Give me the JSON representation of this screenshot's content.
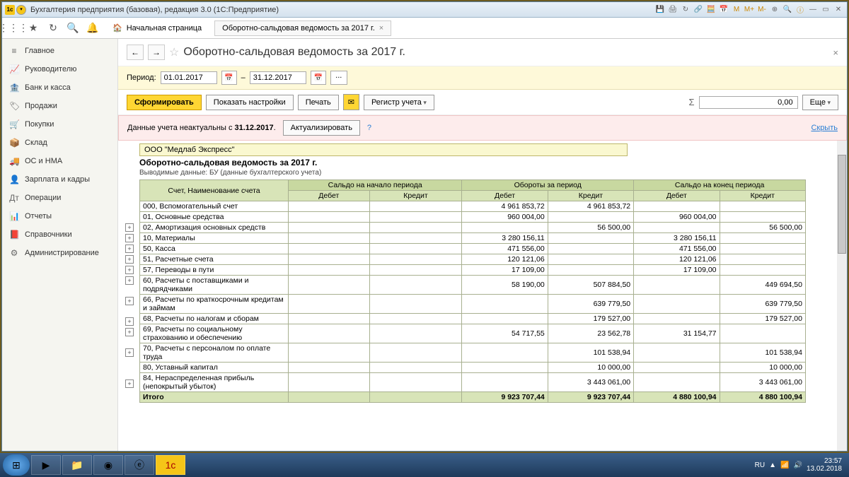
{
  "titlebar": {
    "title": "Бухгалтерия предприятия (базовая), редакция 3.0  (1С:Предприятие)"
  },
  "toolbar2": {
    "home_label": "Начальная страница",
    "tab_label": "Оборотно-сальдовая ведомость за 2017 г."
  },
  "sidebar": {
    "items": [
      {
        "icon": "≡",
        "label": "Главное"
      },
      {
        "icon": "📈",
        "label": "Руководителю"
      },
      {
        "icon": "🏦",
        "label": "Банк и касса"
      },
      {
        "icon": "🏷",
        "label": "Продажи"
      },
      {
        "icon": "🛒",
        "label": "Покупки"
      },
      {
        "icon": "📦",
        "label": "Склад"
      },
      {
        "icon": "🚚",
        "label": "ОС и НМА"
      },
      {
        "icon": "👤",
        "label": "Зарплата и кадры"
      },
      {
        "icon": "Дт",
        "label": "Операции"
      },
      {
        "icon": "📊",
        "label": "Отчеты"
      },
      {
        "icon": "📕",
        "label": "Справочники"
      },
      {
        "icon": "⚙",
        "label": "Администрирование"
      }
    ]
  },
  "page": {
    "title": "Оборотно-сальдовая ведомость за 2017 г.",
    "period_label": "Период:",
    "date_from": "01.01.2017",
    "date_to": "31.12.2017",
    "dash": "–",
    "form_btn": "Сформировать",
    "settings_btn": "Показать настройки",
    "print_btn": "Печать",
    "register_btn": "Регистр учета",
    "sum_value": "0,00",
    "more_btn": "Еще",
    "warn_text": "Данные учета неактуальны с ",
    "warn_date": "31.12.2017",
    "warn_update": "Актуализировать",
    "warn_hide": "Скрыть"
  },
  "report": {
    "org": "ООО \"Медлаб Экспресс\"",
    "title": "Оборотно-сальдовая ведомость за 2017 г.",
    "sub": "Выводимые данные:  БУ (данные бухгалтерского учета)",
    "col_account": "Счет, Наименование счета",
    "grp_start": "Сальдо на начало периода",
    "grp_turn": "Обороты за период",
    "grp_end": "Сальдо на конец периода",
    "col_debit": "Дебет",
    "col_credit": "Кредит",
    "rows": [
      {
        "acc": "000, Вспомогательный счет",
        "sd": "",
        "sc": "",
        "td": "4 961 853,72",
        "tc": "4 961 853,72",
        "ed": "",
        "ec": ""
      },
      {
        "acc": "01, Основные средства",
        "sd": "",
        "sc": "",
        "td": "960 004,00",
        "tc": "",
        "ed": "960 004,00",
        "ec": ""
      },
      {
        "acc": "02, Амортизация основных средств",
        "sd": "",
        "sc": "",
        "td": "",
        "tc": "56 500,00",
        "ed": "",
        "ec": "56 500,00"
      },
      {
        "acc": "10, Материалы",
        "sd": "",
        "sc": "",
        "td": "3 280 156,11",
        "tc": "",
        "ed": "3 280 156,11",
        "ec": ""
      },
      {
        "acc": "50, Касса",
        "sd": "",
        "sc": "",
        "td": "471 556,00",
        "tc": "",
        "ed": "471 556,00",
        "ec": ""
      },
      {
        "acc": "51, Расчетные счета",
        "sd": "",
        "sc": "",
        "td": "120 121,06",
        "tc": "",
        "ed": "120 121,06",
        "ec": ""
      },
      {
        "acc": "57, Переводы в пути",
        "sd": "",
        "sc": "",
        "td": "17 109,00",
        "tc": "",
        "ed": "17 109,00",
        "ec": ""
      },
      {
        "acc": "60, Расчеты с поставщиками и подрядчиками",
        "sd": "",
        "sc": "",
        "td": "58 190,00",
        "tc": "507 884,50",
        "ed": "",
        "ec": "449 694,50"
      },
      {
        "acc": "66, Расчеты по краткосрочным кредитам и займам",
        "sd": "",
        "sc": "",
        "td": "",
        "tc": "639 779,50",
        "ed": "",
        "ec": "639 779,50"
      },
      {
        "acc": "68, Расчеты по налогам и сборам",
        "sd": "",
        "sc": "",
        "td": "",
        "tc": "179 527,00",
        "ed": "",
        "ec": "179 527,00"
      },
      {
        "acc": "69, Расчеты по социальному страхованию и обеспечению",
        "sd": "",
        "sc": "",
        "td": "54 717,55",
        "tc": "23 562,78",
        "ed": "31 154,77",
        "ec": ""
      },
      {
        "acc": "70, Расчеты с персоналом по оплате труда",
        "sd": "",
        "sc": "",
        "td": "",
        "tc": "101 538,94",
        "ed": "",
        "ec": "101 538,94"
      },
      {
        "acc": "80, Уставный капитал",
        "sd": "",
        "sc": "",
        "td": "",
        "tc": "10 000,00",
        "ed": "",
        "ec": "10 000,00"
      },
      {
        "acc": "84, Нераспределенная прибыль (непокрытый убыток)",
        "sd": "",
        "sc": "",
        "td": "",
        "tc": "3 443 061,00",
        "ed": "",
        "ec": "3 443 061,00"
      }
    ],
    "total_label": "Итого",
    "total": {
      "sd": "",
      "sc": "",
      "td": "9 923 707,44",
      "tc": "9 923 707,44",
      "ed": "4 880 100,94",
      "ec": "4 880 100,94"
    }
  },
  "taskbar": {
    "lang": "RU",
    "time": "23:57",
    "date": "13.02.2018"
  }
}
